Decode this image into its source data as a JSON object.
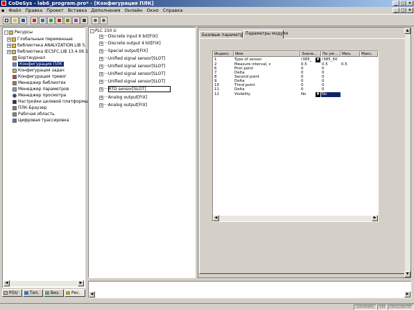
{
  "window": {
    "title": "CoDeSys - lab6_program.pro* - [Конфигурация ПЛК]"
  },
  "menu": [
    "Файл",
    "Правка",
    "Проект",
    "Вставка",
    "Дополнения",
    "Онлайн",
    "Окно",
    "Справка"
  ],
  "resources": {
    "root": "Ресурсы",
    "items": [
      {
        "label": "Глобальные переменные",
        "icon": "folder-icon"
      },
      {
        "label": "библиотека ANALYZATION.LIB 5.",
        "icon": "folder-icon"
      },
      {
        "label": "библиотека IECSFC.LIB 13.4.06 15",
        "icon": "folder-icon"
      },
      {
        "label": "Бортжурнал",
        "icon": "log-icon"
      },
      {
        "label": "Конфигурация ПЛК",
        "icon": "plc-config-icon"
      },
      {
        "label": "Конфигурация задач",
        "icon": "tasks-icon"
      },
      {
        "label": "Конфигурация тревог",
        "icon": "alarm-icon"
      },
      {
        "label": "Менеджер библиотек",
        "icon": "library-icon"
      },
      {
        "label": "Менеджер параметров",
        "icon": "params-icon"
      },
      {
        "label": "Менеджер просмотра",
        "icon": "watch-icon"
      },
      {
        "label": "Настройки целевой платформы",
        "icon": "target-icon"
      },
      {
        "label": "ПЛК-Браузер",
        "icon": "browser-icon"
      },
      {
        "label": "Рабочая область",
        "icon": "workspace-icon"
      },
      {
        "label": "Цифровая трассировка",
        "icon": "trace-icon"
      }
    ],
    "selected": 4
  },
  "object_tabs": [
    "POU",
    "Тип.",
    "Виз.",
    "Рес."
  ],
  "plc_tree": {
    "root": "PLC 150 U",
    "items": [
      "Discrete input 6 bit[FIX]",
      "Discrete output 4 bit[FIX]",
      "Special output[FIX]",
      "Unified signal sensor[SLOT]",
      "Unified signal sensor[SLOT]",
      "Unified signal sensor[SLOT]",
      "Unified signal sensor[SLOT]",
      "RTD sensor[SLOT]",
      "Analog output[FIX]",
      "Analog output[FIX]"
    ],
    "focused": 7
  },
  "param_tabs": [
    "Базовые параметры",
    "Параметры модуля"
  ],
  "param_table": {
    "columns": [
      "Индекс",
      "Имя",
      "Значе...",
      "По ум...",
      "Мин.",
      "Макс."
    ],
    "rows": [
      {
        "index": "1",
        "name": "Type of sensor",
        "value": "r385_",
        "default": "r385_50",
        "min": "",
        "max": ""
      },
      {
        "index": "2",
        "name": "Measure interval, s",
        "value": "0.5",
        "default": "0.5",
        "min": "0.5",
        "max": ""
      },
      {
        "index": "6",
        "name": "First point",
        "value": "0",
        "default": "0",
        "min": "",
        "max": ""
      },
      {
        "index": "7",
        "name": "Delta",
        "value": "0",
        "default": "0",
        "min": "",
        "max": ""
      },
      {
        "index": "8",
        "name": "Second point",
        "value": "0",
        "default": "0",
        "min": "",
        "max": ""
      },
      {
        "index": "9",
        "name": "Delta",
        "value": "0",
        "default": "0",
        "min": "",
        "max": ""
      },
      {
        "index": "10",
        "name": "Third point",
        "value": "0",
        "default": "0",
        "min": "",
        "max": ""
      },
      {
        "index": "11",
        "name": "Delta",
        "value": "0",
        "default": "0",
        "min": "",
        "max": ""
      },
      {
        "index": "12",
        "name": "Visibility",
        "value": "No",
        "default": "No",
        "min": "",
        "max": ""
      }
    ]
  },
  "status": [
    "ОНЛАЙН",
    "ЭМ",
    "ПРОСМОТР"
  ],
  "colors": {
    "titlebar": "#0a246a",
    "selection": "#0a246a",
    "face": "#d4d0c8"
  }
}
